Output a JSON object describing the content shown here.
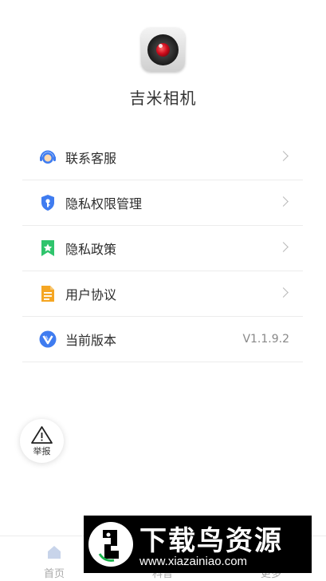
{
  "app": {
    "name": "吉米相机"
  },
  "menu": [
    {
      "label": "联系客服",
      "icon": "customer-service-icon"
    },
    {
      "label": "隐私权限管理",
      "icon": "privacy-shield-icon"
    },
    {
      "label": "隐私政策",
      "icon": "bookmark-star-icon"
    },
    {
      "label": "用户协议",
      "icon": "document-icon"
    },
    {
      "label": "当前版本",
      "icon": "version-v-icon",
      "value": "V1.1.9.2"
    }
  ],
  "report": {
    "label": "举报"
  },
  "tabs": [
    {
      "label": "首页",
      "icon": "home-icon"
    },
    {
      "label": "科普",
      "icon": "book-icon"
    },
    {
      "label": "更多",
      "icon": "more-icon"
    }
  ],
  "watermark": {
    "title": "下载鸟资源",
    "url": "www.xiazainiao.com"
  },
  "colors": {
    "accent_blue": "#3f7cf0",
    "green": "#2fc46c",
    "orange": "#f5a623"
  }
}
